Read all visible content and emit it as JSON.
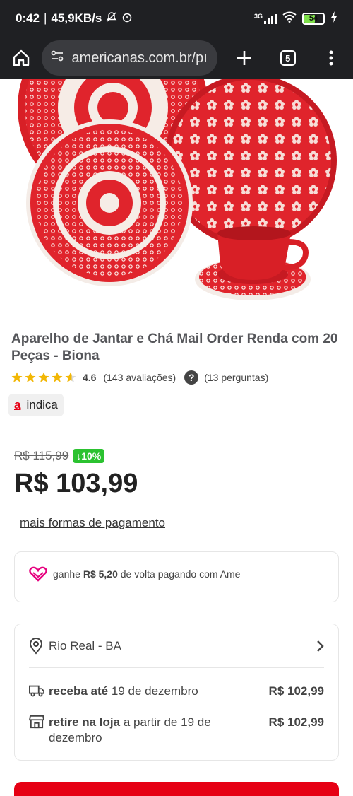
{
  "status": {
    "time": "0:42",
    "speed": "45,9KB/s",
    "network": "3G",
    "battery": "54"
  },
  "browser": {
    "url": "americanas.com.br/pı",
    "tab_count": "5"
  },
  "product": {
    "title": "Aparelho de Jantar e Chá Mail Order Renda com 20 Peças - Biona",
    "rating": "4.6",
    "reviews": "(143 avaliações)",
    "questions": "(13 perguntas)",
    "badge": "indica",
    "old_price": "R$ 115,99",
    "discount": "↓10%",
    "price": "R$ 103,99",
    "more_payment": "mais formas de pagamento"
  },
  "cashback": {
    "prefix": "ganhe",
    "amount": "R$ 5,20",
    "suffix": "de volta pagando com Ame"
  },
  "delivery": {
    "location": "Rio Real - BA",
    "receive_label": "receba até",
    "receive_date": "19 de dezembro",
    "receive_price": "R$ 102,99",
    "pickup_label": "retire na loja",
    "pickup_date": "a partir de 19 de dezembro",
    "pickup_price": "R$ 102,99"
  },
  "colors": {
    "brand_red": "#e60014",
    "discount_green": "#2bc230",
    "dark_bar": "#1f2023"
  }
}
